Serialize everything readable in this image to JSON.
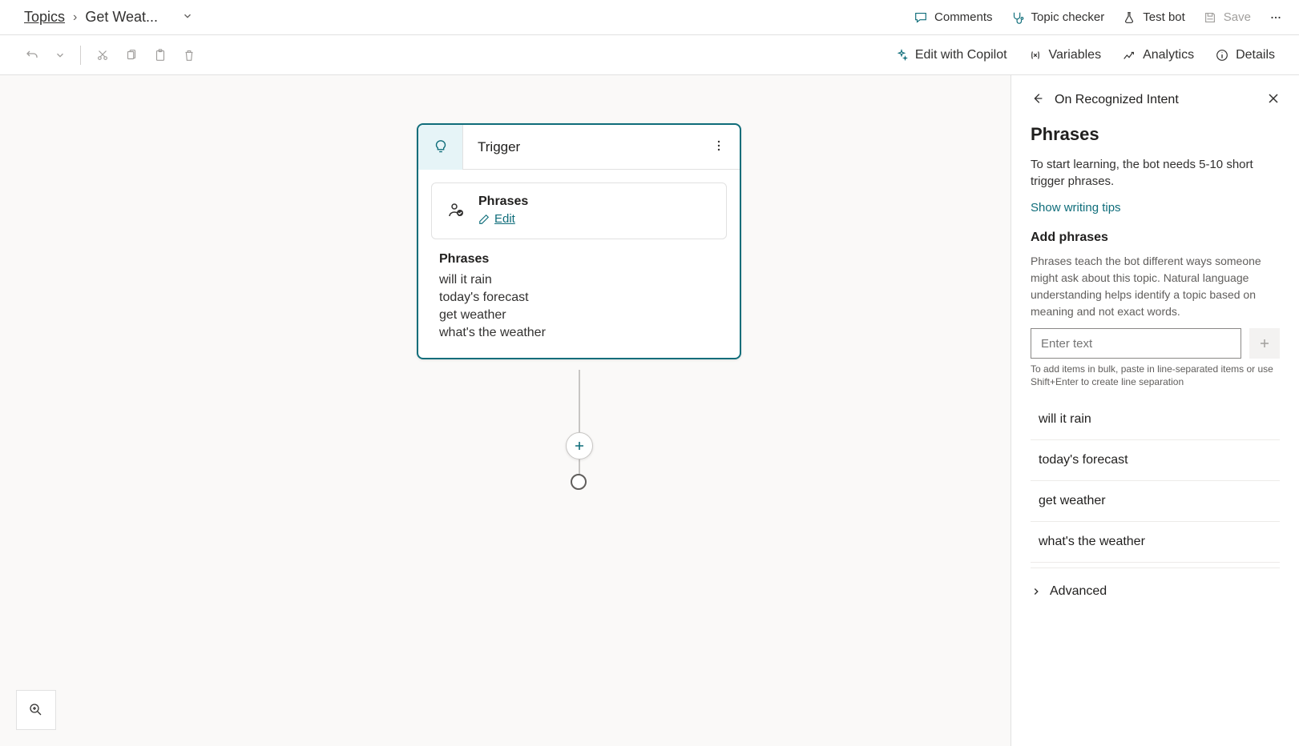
{
  "breadcrumb": {
    "root": "Topics",
    "current": "Get Weat..."
  },
  "header_actions": {
    "comments": "Comments",
    "topic_checker": "Topic checker",
    "test_bot": "Test bot",
    "save": "Save"
  },
  "toolbar_right": {
    "copilot": "Edit with Copilot",
    "variables": "Variables",
    "analytics": "Analytics",
    "details": "Details"
  },
  "node": {
    "title": "Trigger",
    "phrases_label": "Phrases",
    "edit_label": "Edit",
    "phrases_heading": "Phrases",
    "phrases": [
      "will it rain",
      "today's forecast",
      "get weather",
      "what's the weather"
    ]
  },
  "panel": {
    "context": "On Recognized Intent",
    "title": "Phrases",
    "desc": "To start learning, the bot needs 5-10 short trigger phrases.",
    "tips_link": "Show writing tips",
    "add_heading": "Add phrases",
    "add_desc": "Phrases teach the bot different ways someone might ask about this topic. Natural language understanding helps identify a topic based on meaning and not exact words.",
    "input_placeholder": "Enter text",
    "bulk_hint": "To add items in bulk, paste in line-separated items or use Shift+Enter to create line separation",
    "phrases": [
      "will it rain",
      "today's forecast",
      "get weather",
      "what's the weather"
    ],
    "advanced": "Advanced"
  }
}
